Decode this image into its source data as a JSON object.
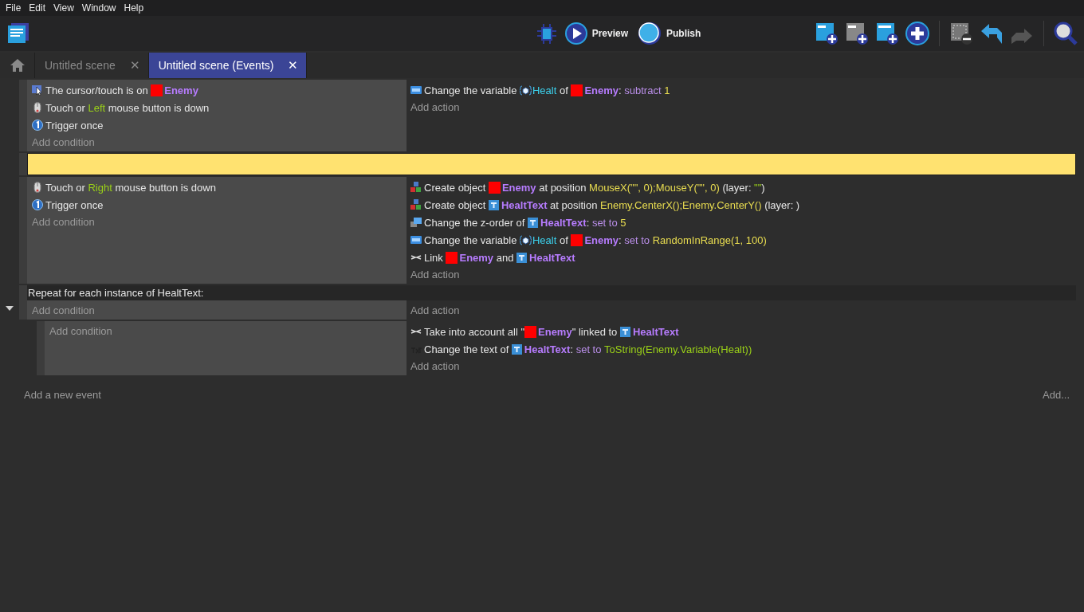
{
  "menu": [
    "File",
    "Edit",
    "View",
    "Window",
    "Help"
  ],
  "toolbar": {
    "preview": "Preview",
    "publish": "Publish"
  },
  "tabs": [
    {
      "kind": "home",
      "selected": false
    },
    {
      "kind": "scene",
      "label": "Untitled scene",
      "close": "✕",
      "selected": false
    },
    {
      "kind": "scene",
      "label": "Untitled scene (Events)",
      "close": "✕",
      "selected": true
    }
  ],
  "events": [
    {
      "kind": "standard",
      "conditions": [
        {
          "kind": "cursor",
          "parts": [
            {
              "kind": "text",
              "text": "The cursor/touch is on "
            },
            {
              "kind": "sprite_object",
              "text": "Enemy"
            }
          ]
        },
        {
          "kind": "mouse",
          "parts": [
            {
              "kind": "text",
              "text": "Touch or "
            },
            {
              "kind": "param",
              "text": "Left"
            },
            {
              "kind": "text",
              "text": " mouse button is down"
            }
          ]
        },
        {
          "kind": "once",
          "parts": [
            {
              "kind": "text",
              "text": "Trigger once"
            }
          ]
        }
      ],
      "add_condition": "Add condition",
      "actions": [
        {
          "kind": "variable",
          "parts": [
            {
              "kind": "text",
              "text": "Change the variable "
            },
            {
              "kind": "variable",
              "text": "Healt"
            },
            {
              "kind": "text",
              "text": " of "
            },
            {
              "kind": "sprite_object",
              "text": "Enemy"
            },
            {
              "kind": "text",
              "text": ": "
            },
            {
              "kind": "operator",
              "text": "subtract "
            },
            {
              "kind": "value",
              "text": "1"
            }
          ]
        }
      ],
      "add_action": "Add action"
    },
    {
      "kind": "comment",
      "selected": true
    },
    {
      "kind": "standard",
      "conditions": [
        {
          "kind": "mouse",
          "parts": [
            {
              "kind": "text",
              "text": "Touch or "
            },
            {
              "kind": "param",
              "text": "Right"
            },
            {
              "kind": "text",
              "text": " mouse button is down"
            }
          ]
        },
        {
          "kind": "once",
          "parts": [
            {
              "kind": "text",
              "text": "Trigger once"
            }
          ]
        }
      ],
      "add_condition": "Add condition",
      "actions": [
        {
          "kind": "create",
          "parts": [
            {
              "kind": "text",
              "text": "Create object "
            },
            {
              "kind": "sprite_object",
              "text": "Enemy"
            },
            {
              "kind": "text",
              "text": " at position "
            },
            {
              "kind": "value",
              "text": "MouseX(\"\", 0);MouseY(\"\", 0)"
            },
            {
              "kind": "text",
              "text": " (layer: "
            },
            {
              "kind": "param",
              "text": "\"\""
            },
            {
              "kind": "text",
              "text": ")"
            }
          ]
        },
        {
          "kind": "create",
          "parts": [
            {
              "kind": "text",
              "text": "Create object "
            },
            {
              "kind": "text_object",
              "text": "HealtText"
            },
            {
              "kind": "text",
              "text": " at position "
            },
            {
              "kind": "value",
              "text": "Enemy.CenterX();Enemy.CenterY()"
            },
            {
              "kind": "text",
              "text": " (layer: )"
            }
          ]
        },
        {
          "kind": "zorder",
          "parts": [
            {
              "kind": "text",
              "text": "Change the z-order of "
            },
            {
              "kind": "text_object",
              "text": "HealtText"
            },
            {
              "kind": "text",
              "text": ": "
            },
            {
              "kind": "operator",
              "text": "set to "
            },
            {
              "kind": "value",
              "text": "5"
            }
          ]
        },
        {
          "kind": "variable",
          "parts": [
            {
              "kind": "text",
              "text": "Change the variable "
            },
            {
              "kind": "variable",
              "text": "Healt"
            },
            {
              "kind": "text",
              "text": " of "
            },
            {
              "kind": "sprite_object",
              "text": "Enemy"
            },
            {
              "kind": "text",
              "text": ": "
            },
            {
              "kind": "operator",
              "text": "set to "
            },
            {
              "kind": "value",
              "text": "RandomInRange(1, 100)"
            }
          ]
        },
        {
          "kind": "link",
          "parts": [
            {
              "kind": "text",
              "text": "Link "
            },
            {
              "kind": "sprite_object",
              "text": "Enemy"
            },
            {
              "kind": "text",
              "text": " and "
            },
            {
              "kind": "text_object",
              "text": "HealtText"
            }
          ]
        }
      ],
      "add_action": "Add action"
    },
    {
      "kind": "repeat",
      "expanded": true,
      "header": "Repeat for each instance of HealtText:",
      "add_condition": "Add condition",
      "add_action": "Add action",
      "children": [
        {
          "kind": "standard",
          "add_condition": "Add condition",
          "actions": [
            {
              "kind": "link",
              "parts": [
                {
                  "kind": "text",
                  "text": "Take into account all \""
                },
                {
                  "kind": "sprite_object",
                  "text": "Enemy"
                },
                {
                  "kind": "text",
                  "text": "\" linked to "
                },
                {
                  "kind": "text_object",
                  "text": "HealtText"
                }
              ]
            },
            {
              "kind": "text",
              "parts": [
                {
                  "kind": "text",
                  "text": "Change the text of "
                },
                {
                  "kind": "text_object",
                  "text": "HealtText"
                },
                {
                  "kind": "text",
                  "text": ": "
                },
                {
                  "kind": "operator",
                  "text": "set to "
                },
                {
                  "kind": "param",
                  "text": "ToString(Enemy.Variable(Healt))"
                }
              ]
            }
          ],
          "add_action": "Add action"
        }
      ]
    }
  ],
  "footer": {
    "add_event": "Add a new event",
    "add_other": "Add..."
  }
}
